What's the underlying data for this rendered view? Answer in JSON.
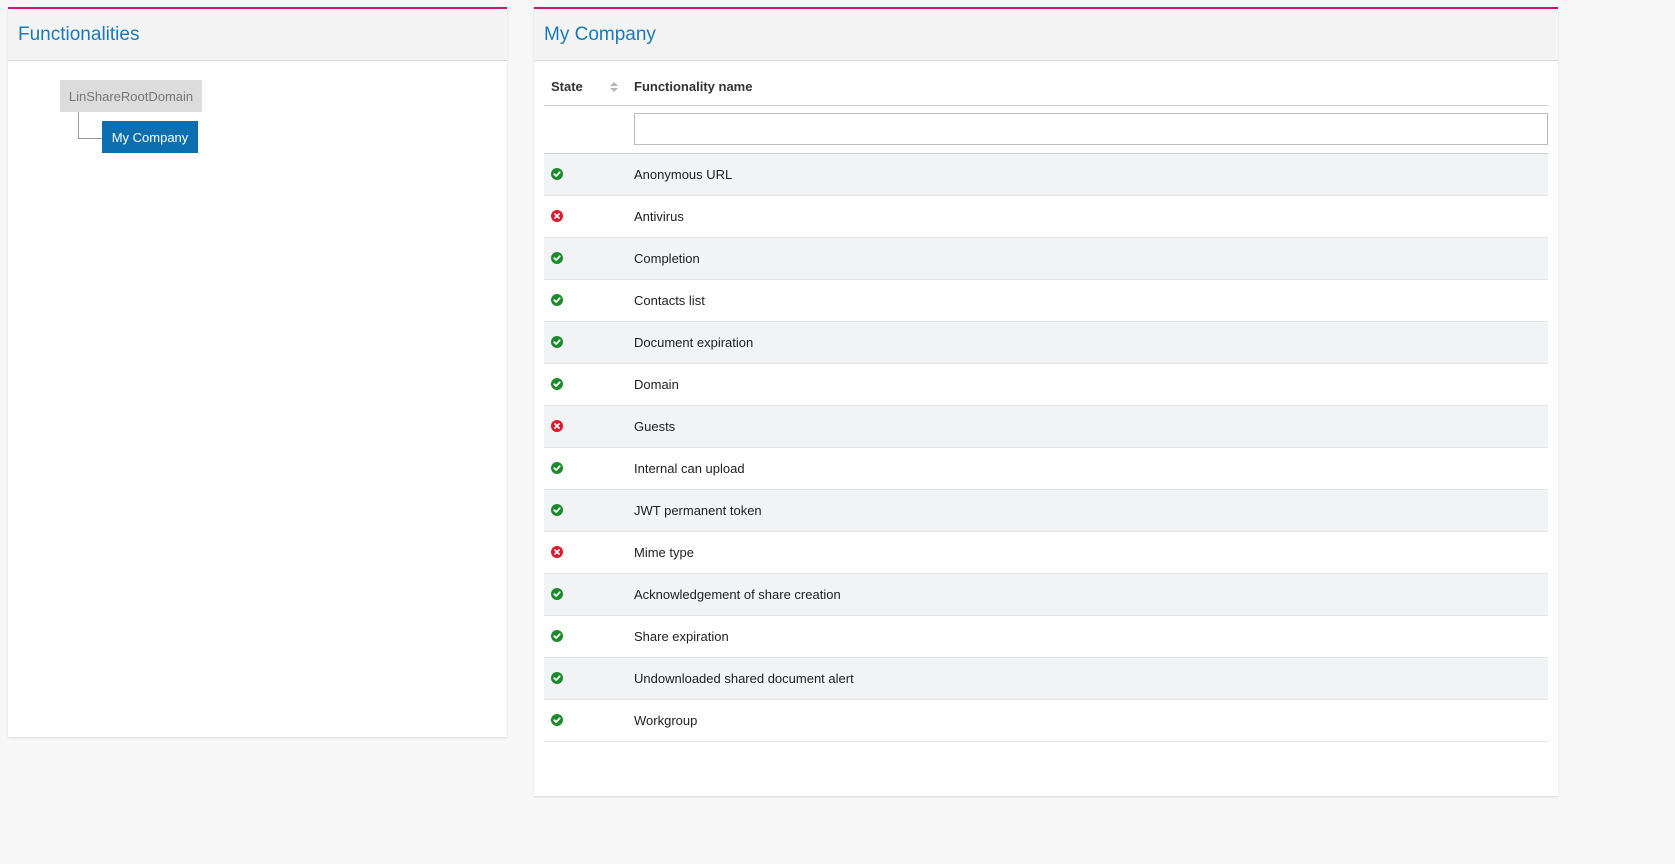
{
  "left_panel": {
    "title": "Functionalities",
    "tree": {
      "root": "LinShareRootDomain",
      "child": "My Company"
    }
  },
  "right_panel": {
    "title": "My Company",
    "table": {
      "headers": {
        "state": "State",
        "name": "Functionality name"
      },
      "filter": {
        "value": "",
        "placeholder": ""
      },
      "rows": [
        {
          "state": "enabled",
          "name": "Anonymous URL"
        },
        {
          "state": "disabled",
          "name": "Antivirus"
        },
        {
          "state": "enabled",
          "name": "Completion"
        },
        {
          "state": "enabled",
          "name": "Contacts list"
        },
        {
          "state": "enabled",
          "name": "Document expiration"
        },
        {
          "state": "enabled",
          "name": "Domain"
        },
        {
          "state": "disabled",
          "name": "Guests"
        },
        {
          "state": "enabled",
          "name": "Internal can upload"
        },
        {
          "state": "enabled",
          "name": "JWT permanent token"
        },
        {
          "state": "disabled",
          "name": "Mime type"
        },
        {
          "state": "enabled",
          "name": "Acknowledgement of share creation"
        },
        {
          "state": "enabled",
          "name": "Share expiration"
        },
        {
          "state": "enabled",
          "name": "Undownloaded shared document alert"
        },
        {
          "state": "enabled",
          "name": "Workgroup"
        }
      ]
    }
  },
  "colors": {
    "accent_border": "#c8186e",
    "title": "#1a7ab8",
    "selected_node": "#0b6fb0",
    "enabled_icon": "#1e8a2e",
    "disabled_icon": "#e0162b"
  },
  "icons": {
    "enabled": "check-circle-icon",
    "disabled": "x-circle-icon",
    "sort": "sort-icon"
  }
}
